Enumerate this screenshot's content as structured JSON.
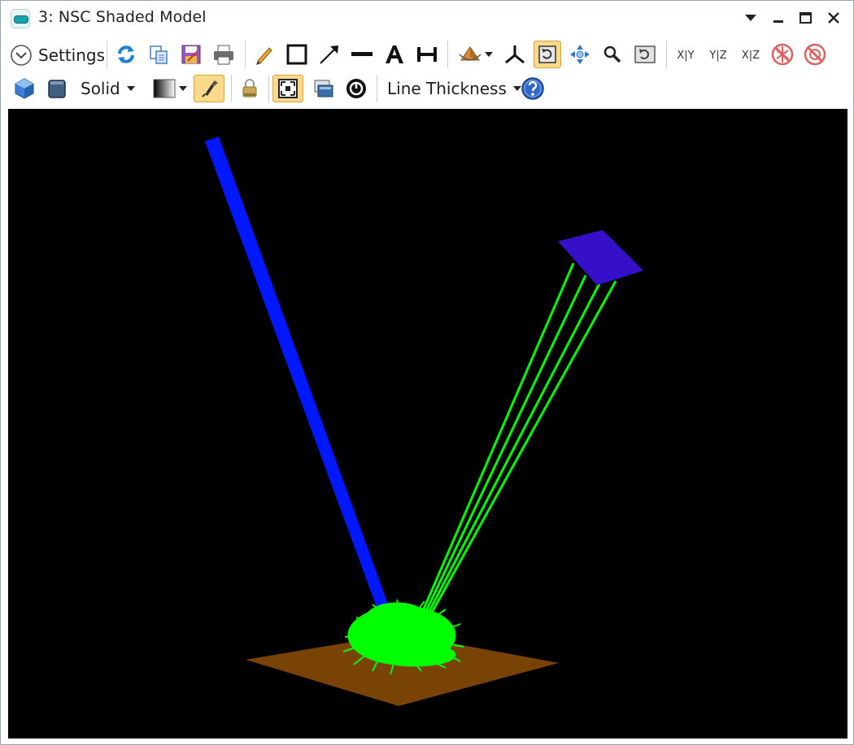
{
  "window": {
    "title": "3: NSC Shaded Model"
  },
  "toolbar": {
    "settings_label": "Settings",
    "solid_label": "Solid",
    "line_thickness_label": "Line Thickness",
    "view_xy_label": "X|Y",
    "view_yz_label": "Y|Z",
    "view_xz_label": "X|Z"
  },
  "icons": [
    "settings-chevron-icon",
    "refresh-icon",
    "copy-icon",
    "save-icon",
    "print-icon",
    "pencil-icon",
    "rectangle-icon",
    "arrow-icon",
    "line-icon",
    "text-icon",
    "dimension-icon",
    "rotate-view-icon",
    "axes-icon",
    "rotate-icon",
    "pan-icon",
    "zoom-icon",
    "reset-view-icon",
    "cube-icon",
    "cylinder-icon",
    "gradient-icon",
    "flashlight-icon",
    "lock-icon",
    "fit-icon",
    "layers-icon",
    "clock-icon",
    "help-icon"
  ],
  "colors": {
    "viewport_background": "#000000",
    "source_beam": "#0018ff",
    "rays": "#00ff00",
    "detector": "#3510c8",
    "ground_plane": "#7a4306",
    "active_button": "#fbd98b"
  }
}
